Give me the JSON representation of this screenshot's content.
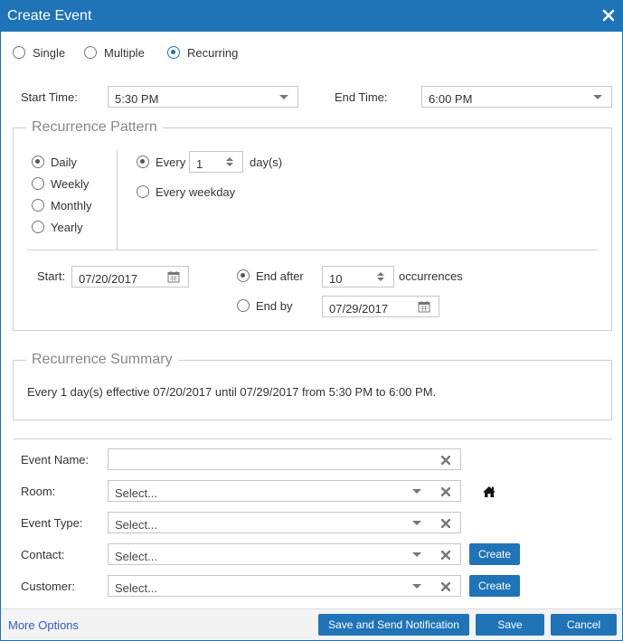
{
  "dialog": {
    "title": "Create Event"
  },
  "mode": {
    "options": [
      "Single",
      "Multiple",
      "Recurring"
    ],
    "selected": "Recurring"
  },
  "time": {
    "start_label": "Start Time:",
    "start_value": "5:30 PM",
    "end_label": "End Time:",
    "end_value": "6:00 PM"
  },
  "pattern": {
    "legend": "Recurrence Pattern",
    "frequencies": [
      "Daily",
      "Weekly",
      "Monthly",
      "Yearly"
    ],
    "selected_frequency": "Daily",
    "every_label": "Every",
    "every_value": "1",
    "every_unit": "day(s)",
    "every_weekday_label": "Every weekday",
    "start_label": "Start:",
    "start_date": "07/20/2017",
    "end_after_label": "End after",
    "end_after_value": "10",
    "occurrences_label": "occurrences",
    "end_by_label": "End by",
    "end_by_date": "07/29/2017"
  },
  "summary": {
    "legend": "Recurrence Summary",
    "text": "Every 1 day(s) effective 07/20/2017 until 07/29/2017 from 5:30 PM to 6:00 PM."
  },
  "form": {
    "event_name_label": "Event Name:",
    "event_name_value": "",
    "room_label": "Room:",
    "room_placeholder": "Select...",
    "event_type_label": "Event Type:",
    "event_type_placeholder": "Select...",
    "contact_label": "Contact:",
    "contact_placeholder": "Select...",
    "customer_label": "Customer:",
    "customer_placeholder": "Select...",
    "create_label": "Create"
  },
  "footer": {
    "more_options": "More Options",
    "save_notify": "Save and Send Notification",
    "save": "Save",
    "cancel": "Cancel"
  },
  "colors": {
    "accent": "#1f73b7",
    "link": "#2d5bd1"
  }
}
